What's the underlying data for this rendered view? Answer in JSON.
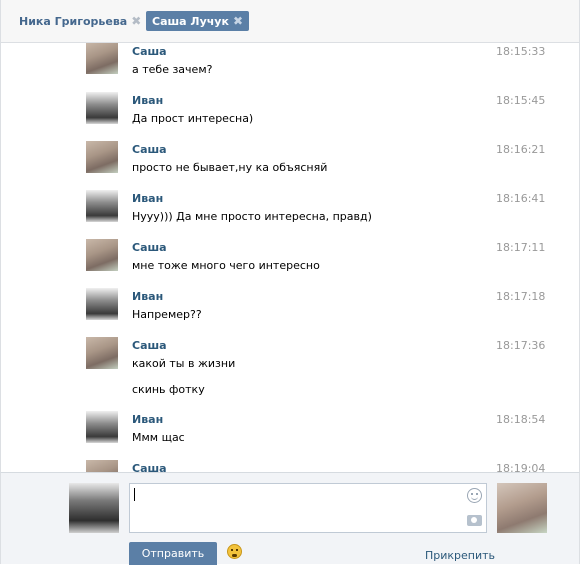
{
  "tabs": [
    {
      "label": "Ника Григорьева",
      "active": false
    },
    {
      "label": "Саша Лучук",
      "active": true
    }
  ],
  "tab_close_glyph": "✖",
  "messages": [
    {
      "author": "Саша",
      "time": "18:15:33",
      "lines": [
        "а тебе зачем?"
      ],
      "avatar": "sasha"
    },
    {
      "author": "Иван",
      "time": "18:15:45",
      "lines": [
        "Да прост интересна)"
      ],
      "avatar": "ivan"
    },
    {
      "author": "Саша",
      "time": "18:16:21",
      "lines": [
        "просто не бывает,ну ка объясняй"
      ],
      "avatar": "sasha"
    },
    {
      "author": "Иван",
      "time": "18:16:41",
      "lines": [
        "Нууу))) Да мне просто интересна, правд)"
      ],
      "avatar": "ivan"
    },
    {
      "author": "Саша",
      "time": "18:17:11",
      "lines": [
        "мне тоже много чего интересно"
      ],
      "avatar": "sasha"
    },
    {
      "author": "Иван",
      "time": "18:17:18",
      "lines": [
        "Напремер??"
      ],
      "avatar": "ivan"
    },
    {
      "author": "Саша",
      "time": "18:17:36",
      "lines": [
        "какой ты в жизни",
        "скинь фотку"
      ],
      "avatar": "sasha"
    },
    {
      "author": "Иван",
      "time": "18:18:54",
      "lines": [
        "Ммм щас"
      ],
      "avatar": "ivan"
    },
    {
      "author": "Саша",
      "time": "18:19:04",
      "lines": [],
      "avatar": "sasha"
    }
  ],
  "composer": {
    "message_value": "",
    "send_label": "Отправить",
    "attach_label": "Прикрепить"
  },
  "icons": {
    "smile": "smile-icon",
    "camera": "camera-icon",
    "emoji": "emoji-icon"
  },
  "colors": {
    "accent": "#5b7fa6",
    "author": "#2b587a",
    "timestamp": "#999999"
  }
}
